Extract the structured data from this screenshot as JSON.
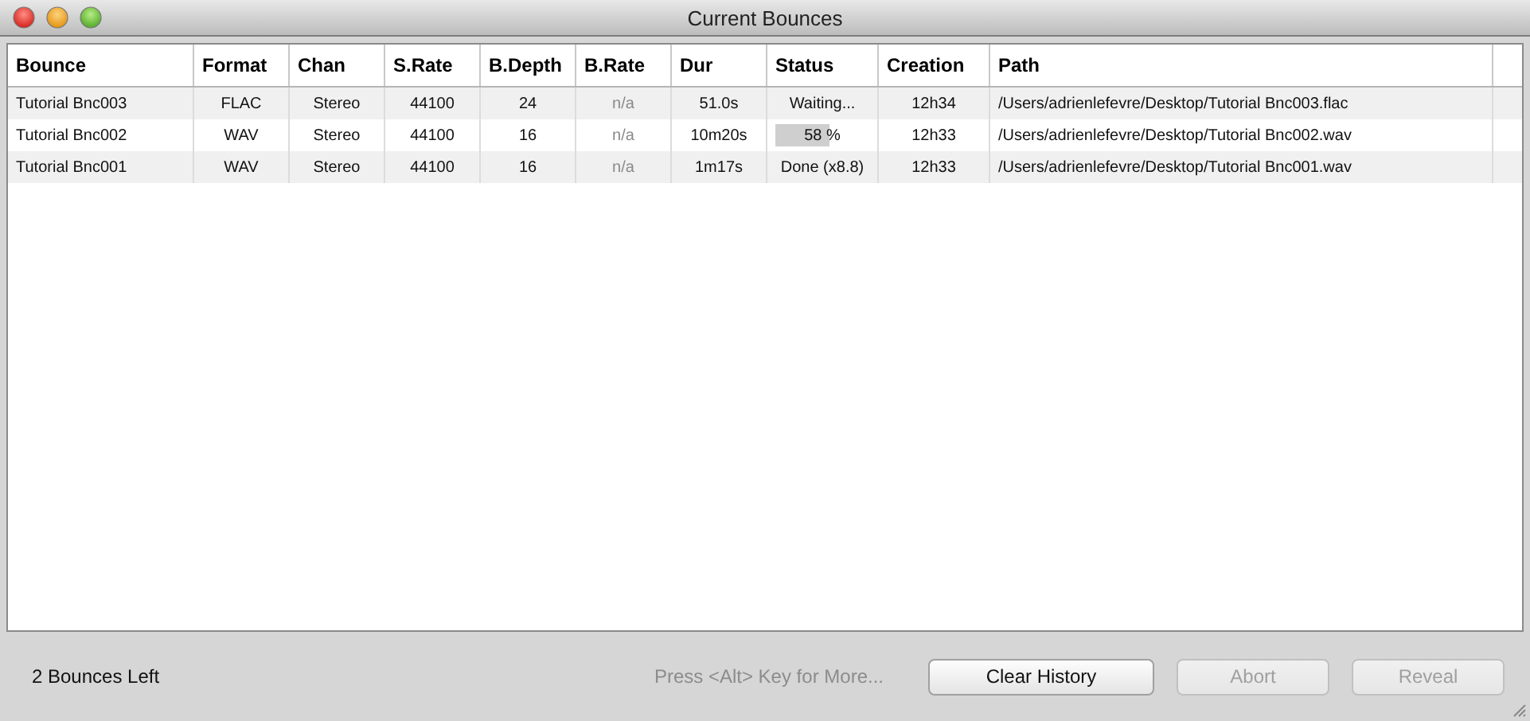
{
  "window": {
    "title": "Current Bounces"
  },
  "table": {
    "columns": [
      {
        "label": "Bounce",
        "muted": false
      },
      {
        "label": "Format",
        "muted": false
      },
      {
        "label": "Chan",
        "muted": false
      },
      {
        "label": "S.Rate",
        "muted": false
      },
      {
        "label": "B.Depth",
        "muted": false
      },
      {
        "label": "B.Rate",
        "muted": true
      },
      {
        "label": "Dur",
        "muted": false
      },
      {
        "label": "Status",
        "muted": false
      },
      {
        "label": "Creation",
        "muted": false
      },
      {
        "label": "Path",
        "muted": false
      }
    ],
    "rows": [
      {
        "cells": [
          "Tutorial Bnc003",
          "FLAC",
          "Stereo",
          "44100",
          "24",
          "n/a",
          "51.0s"
        ],
        "status": {
          "kind": "text",
          "text": "Waiting..."
        },
        "creation": "12h34",
        "path": "/Users/adrienlefevre/Desktop/Tutorial Bnc003.flac"
      },
      {
        "cells": [
          "Tutorial Bnc002",
          "WAV",
          "Stereo",
          "44100",
          "16",
          "n/a",
          "10m20s"
        ],
        "status": {
          "kind": "progress",
          "text": "58 %",
          "level": 0.58
        },
        "creation": "12h33",
        "path": "/Users/adrienlefevre/Desktop/Tutorial Bnc002.wav"
      },
      {
        "cells": [
          "Tutorial Bnc001",
          "WAV",
          "Stereo",
          "44100",
          "16",
          "n/a",
          "1m17s"
        ],
        "status": {
          "kind": "text",
          "text": "Done (x8.8)"
        },
        "creation": "12h33",
        "path": "/Users/adrienlefevre/Desktop/Tutorial Bnc001.wav"
      }
    ]
  },
  "footer": {
    "remaining": "2 Bounces Left",
    "hint": "Press <Alt> Key for More...",
    "buttons": [
      {
        "label": "Clear History",
        "disabled": false
      },
      {
        "label": "Abort",
        "disabled": true
      },
      {
        "label": "Reveal",
        "disabled": true
      }
    ]
  }
}
